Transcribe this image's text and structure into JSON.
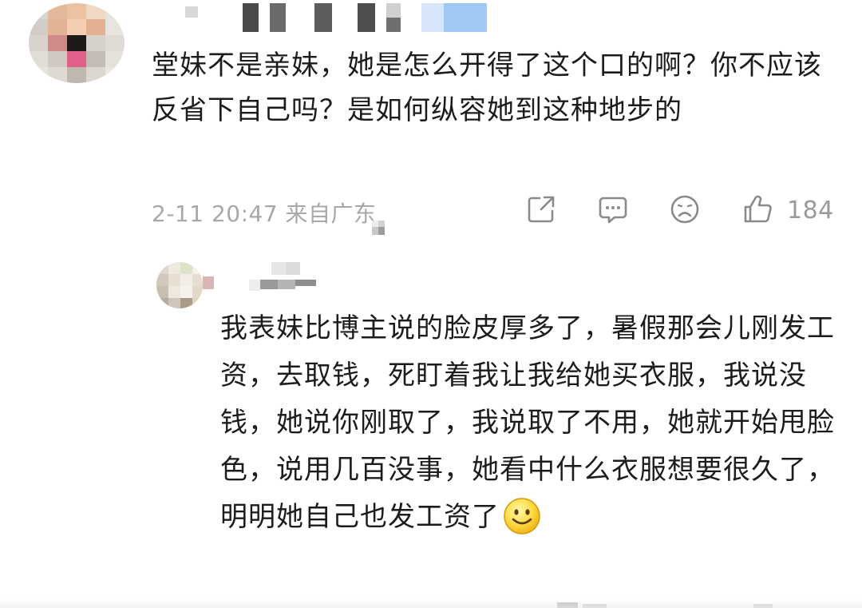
{
  "comment": {
    "text": "堂妹不是亲妹，她是怎么开得了这个口的啊？你不应该反省下自己吗？是如何纵容她到这种地步的",
    "date_time": "2-11 20:47",
    "location": "来自广东",
    "like_count": "184",
    "actions": [
      {
        "name": "share-icon"
      },
      {
        "name": "comment-icon"
      },
      {
        "name": "dislike-icon"
      },
      {
        "name": "like-icon"
      }
    ]
  },
  "reply": {
    "text": "我表妹比博主说的脸皮厚多了，暑假那会儿刚发工资，去取钱，死盯着我让我给她买衣服，我说没钱，她说你刚取了，我说取了不用，她就开始甩脸色，说用几百没事，她看中什么衣服想要很久了，明明她自己也发工资了",
    "emoji": "smiley-face-emoji"
  }
}
